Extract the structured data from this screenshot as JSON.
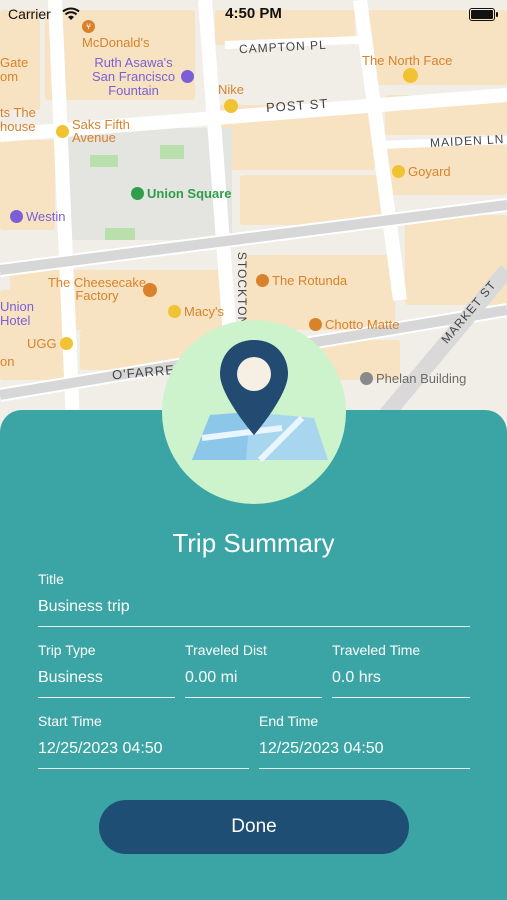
{
  "status_bar": {
    "carrier": "Carrier",
    "time": "4:50 PM"
  },
  "map": {
    "pois": [
      {
        "label": "McDonald's",
        "color": "#d9822b"
      },
      {
        "label": "Ruth Asawa's San Francisco Fountain",
        "color": "#7b5fd6"
      },
      {
        "label": "The North Face",
        "color": "#d9822b"
      },
      {
        "label": "Nike",
        "color": "#d9822b"
      },
      {
        "label": "Saks Fifth Avenue",
        "color": "#d9822b"
      },
      {
        "label": "Goyard",
        "color": "#d9822b"
      },
      {
        "label": "Union Square",
        "color": "#2f9e4a"
      },
      {
        "label": "Westin",
        "color": "#7b5fd6"
      },
      {
        "label": "The Cheesecake Factory",
        "color": "#d9822b"
      },
      {
        "label": "The Rotunda",
        "color": "#d9822b"
      },
      {
        "label": "Macy's",
        "color": "#d9822b"
      },
      {
        "label": "Union Hotel",
        "color": "#7b5fd6"
      },
      {
        "label": "UGG",
        "color": "#d9822b"
      },
      {
        "label": "Chotto Matte",
        "color": "#d9822b"
      },
      {
        "label": "Phelan Building",
        "color": "#6c6c6c"
      }
    ],
    "streets": [
      "CAMPTON PL",
      "POST ST",
      "MAIDEN LN",
      "STOCKTON",
      "O'FARRELL",
      "MARKET ST"
    ],
    "partial_labels": [
      "Gate",
      "om",
      "ts The",
      "house",
      "on"
    ]
  },
  "sheet": {
    "title": "Trip Summary",
    "title_field": {
      "label": "Title",
      "value": "Business trip"
    },
    "trip_type": {
      "label": "Trip Type",
      "value": "Business"
    },
    "traveled_dist": {
      "label": "Traveled Dist",
      "value": "0.00 mi"
    },
    "traveled_time": {
      "label": "Traveled Time",
      "value": "0.0 hrs"
    },
    "start_time": {
      "label": "Start Time",
      "value": "12/25/2023 04:50"
    },
    "end_time": {
      "label": "End Time",
      "value": "12/25/2023 04:50"
    },
    "done_label": "Done"
  },
  "colors": {
    "sheet_bg": "#3ba5a5",
    "button_bg": "#1f4e75",
    "badge_bg": "#ccf3cc",
    "pin": "#234a70"
  }
}
